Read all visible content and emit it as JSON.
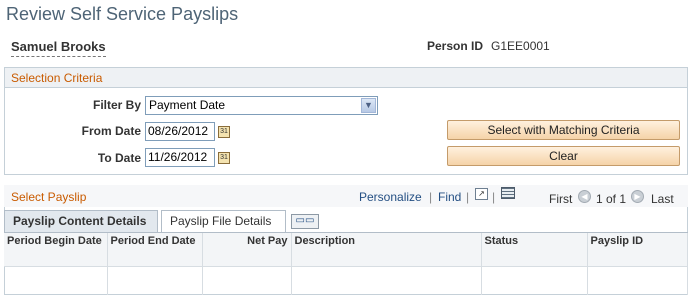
{
  "page": {
    "title": "Review Self Service Payslips"
  },
  "employee": {
    "name": "Samuel Brooks",
    "person_id_label": "Person ID",
    "person_id": "G1EE0001"
  },
  "selection": {
    "header": "Selection Criteria",
    "filter_label": "Filter By",
    "filter_value": "Payment Date",
    "from_label": "From Date",
    "from_value": "08/26/2012",
    "to_label": "To Date",
    "to_value": "11/26/2012",
    "match_button": "Select with Matching Criteria",
    "clear_button": "Clear"
  },
  "payslip": {
    "header": "Select Payslip",
    "personalize": "Personalize",
    "find": "Find",
    "separator": "|",
    "first": "First",
    "count": "1 of 1",
    "last": "Last",
    "tabs": [
      {
        "label": "Payslip Content Details"
      },
      {
        "label": "Payslip File Details"
      }
    ],
    "columns": [
      "Period Begin Date",
      "Period End Date",
      "Net Pay",
      "Description",
      "Status",
      "Payslip ID"
    ]
  },
  "icons": {
    "calendar": "calendar-icon",
    "zoom": "new-window-icon",
    "grid": "download-grid-icon",
    "prev": "previous-icon",
    "next": "next-icon",
    "show_all": "show-all-columns-icon"
  },
  "colors": {
    "accent": "#c95b00",
    "link": "#244f83",
    "button": "#f5d3a8"
  }
}
